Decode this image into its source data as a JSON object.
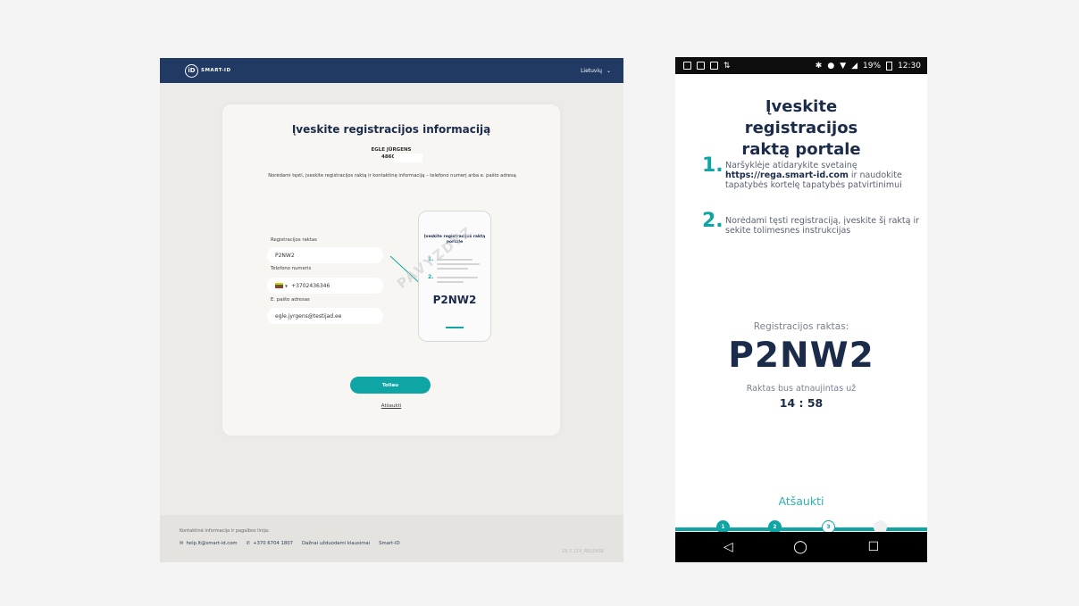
{
  "desktop": {
    "brand": "SMART-ID",
    "language": "Lietuvių",
    "card": {
      "title": "Įveskite registracijos informaciją",
      "user_name": "EGLE JÜRGENS",
      "user_code": "4860",
      "instructions": "Norėdami tęsti, įveskite registracijos raktą ir kontaktinę informaciją – telefono numerį arba e. pašto adresą",
      "fields": {
        "key_label": "Registracijos raktas",
        "key_value": "P2NW2",
        "phone_label": "Telefono numeris",
        "phone_value": "+3702436346",
        "email_label": "E. pašto adresas",
        "email_value": "egle.jyrgens@testijad.ee"
      },
      "preview": {
        "title": "Įveskite registracijos raktą portale",
        "code": "P2NW2",
        "watermark": "PAVYZDYZ"
      },
      "next_button": "Toliau",
      "cancel_link": "Atšaukti"
    },
    "footer": {
      "title": "Kontaktinė informacija ir pagalbos linija:",
      "email": "help.lt@smart-id.com",
      "phone": "+370 6704 1807",
      "faq": "Dažnai užduodami klausimai",
      "brand_link": "Smart-ID",
      "version": "19.7.124_RELEASE"
    }
  },
  "mobile": {
    "status": {
      "battery": "19%",
      "time": "12:30"
    },
    "title": "Įveskite registracijos raktą portale",
    "steps": [
      {
        "num": "1.",
        "before": "Naršyklėje atidarykite svetainę",
        "link": "https://rega.smart-id.com",
        "after": "ir naudokite tapatybės kortelę tapatybės patvirtinimui"
      },
      {
        "num": "2.",
        "text": "Norėdami tęsti registraciją, įveskite šį raktą ir sekite tolimesnes instrukcijas"
      }
    ],
    "key_label": "Registracijos raktas:",
    "key": "P2NW2",
    "renew_label": "Raktas bus atnaujintas už",
    "timer": "14 : 58",
    "cancel": "Atšaukti",
    "progress": [
      "1",
      "2",
      "3"
    ],
    "accent_color": "#0fa5a4",
    "navy_color": "#1b2b4a"
  }
}
